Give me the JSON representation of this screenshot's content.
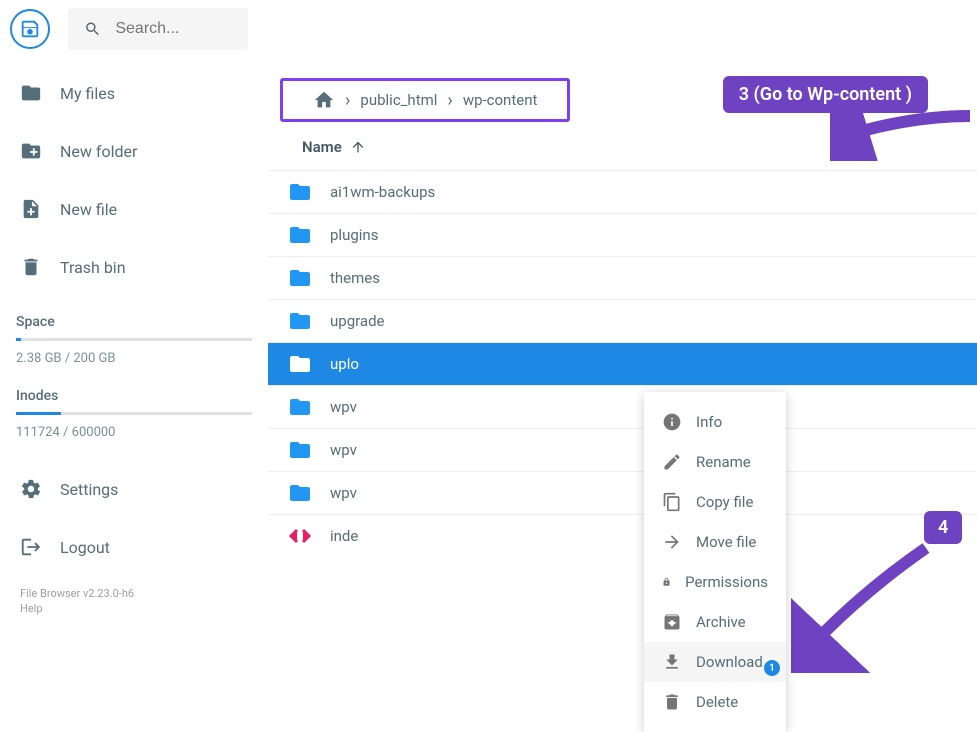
{
  "search": {
    "placeholder": "Search..."
  },
  "sidebar": {
    "items": [
      {
        "label": "My files"
      },
      {
        "label": "New folder"
      },
      {
        "label": "New file"
      },
      {
        "label": "Trash bin"
      }
    ],
    "space": {
      "label": "Space",
      "text": "2.38 GB / 200 GB",
      "pct": 2
    },
    "inodes": {
      "label": "Inodes",
      "text": "111724 / 600000",
      "pct": 19
    },
    "bottom": [
      {
        "label": "Settings"
      },
      {
        "label": "Logout"
      }
    ],
    "footer": {
      "line1": "File Browser v2.23.0-h6",
      "line2": "Help"
    }
  },
  "breadcrumb": {
    "items": [
      "public_html",
      "wp-content"
    ]
  },
  "table": {
    "header": "Name",
    "rows": [
      {
        "name": "ai1wm-backups",
        "type": "folder"
      },
      {
        "name": "plugins",
        "type": "folder"
      },
      {
        "name": "themes",
        "type": "folder"
      },
      {
        "name": "upgrade",
        "type": "folder"
      },
      {
        "name": "uploads",
        "type": "folder",
        "selected": true,
        "truncated": "uplo"
      },
      {
        "name": "wpv",
        "type": "folder"
      },
      {
        "name": "wpv",
        "type": "folder"
      },
      {
        "name": "wpv",
        "type": "folder"
      },
      {
        "name": "inde",
        "type": "code"
      }
    ]
  },
  "context_menu": {
    "items": [
      {
        "label": "Info"
      },
      {
        "label": "Rename"
      },
      {
        "label": "Copy file"
      },
      {
        "label": "Move file"
      },
      {
        "label": "Permissions"
      },
      {
        "label": "Archive"
      },
      {
        "label": "Download",
        "hover": true,
        "badge": "1"
      },
      {
        "label": "Delete"
      }
    ]
  },
  "annotations": {
    "a3": "3 (Go to Wp-content )",
    "a4": "4"
  }
}
